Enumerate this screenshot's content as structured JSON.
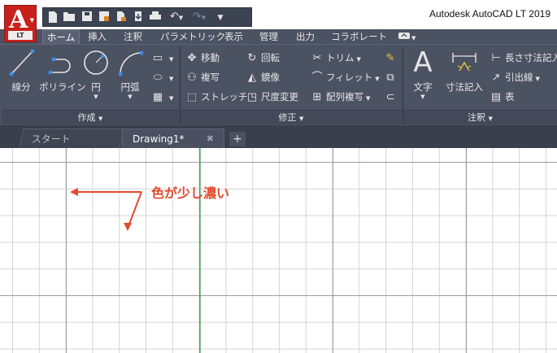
{
  "window": {
    "title": "Autodesk AutoCAD LT 2019"
  },
  "app_logo": {
    "letter": "A",
    "badge": "LT"
  },
  "ribbon_tabs": [
    {
      "label": "ホーム"
    },
    {
      "label": "挿入"
    },
    {
      "label": "注釈"
    },
    {
      "label": "パラメトリック"
    },
    {
      "label": "表示"
    },
    {
      "label": "管理"
    },
    {
      "label": "出力"
    },
    {
      "label": "コラボレート"
    }
  ],
  "panels": {
    "draw": {
      "footer": "作成",
      "line": "線分",
      "polyline": "ポリライン",
      "circle": "円",
      "arc": "円弧"
    },
    "modify": {
      "footer": "修正",
      "move": "移動",
      "rotate": "回転",
      "trim": "トリム",
      "copy": "複写",
      "mirror": "鏡像",
      "fillet": "フィレット",
      "stretch": "ストレッチ",
      "scale": "尺度変更",
      "array": "配列複写"
    },
    "annotation": {
      "footer": "注釈",
      "text": "文字",
      "dimension": "寸法記入",
      "linear": "長さ寸法記入",
      "leader": "引出線",
      "table": "表"
    }
  },
  "doc_tabs": [
    {
      "label": "スタート"
    },
    {
      "label": "Drawing1*"
    }
  ],
  "canvas": {
    "annotation": "色が少し濃い"
  },
  "colors": {
    "accent_red": "#e24a2b",
    "ribbon_bg": "#4b5262",
    "grid_major": "#9a9aa8",
    "grid_minor": "#d4d4dc",
    "y_axis": "#2ea043"
  }
}
